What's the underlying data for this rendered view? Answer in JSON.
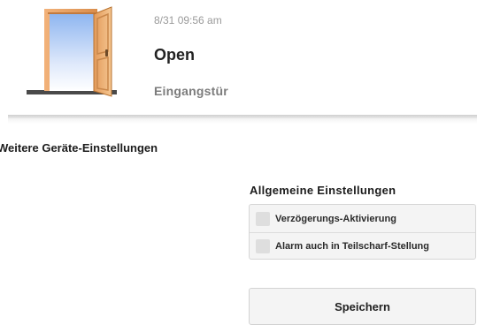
{
  "status": {
    "timestamp": "8/31 09:56 am",
    "state": "Open",
    "device_name": "Eingangstür",
    "icon": "open-door-icon"
  },
  "section": {
    "heading": "Weitere Geräte-Einstellungen"
  },
  "settings": {
    "heading": "Allgemeine Einstellungen",
    "options": [
      {
        "label": "Verzögerungs-Aktivierung",
        "checked": false
      },
      {
        "label": "Alarm auch in Teilscharf-Stellung",
        "checked": false
      }
    ]
  },
  "actions": {
    "save_label": "Speichern"
  },
  "colors": {
    "door_frame": "#e8a468",
    "sky_top": "#8fb6f0",
    "floor": "#4a4a4a",
    "panel_bg": "#f4f4f4"
  }
}
